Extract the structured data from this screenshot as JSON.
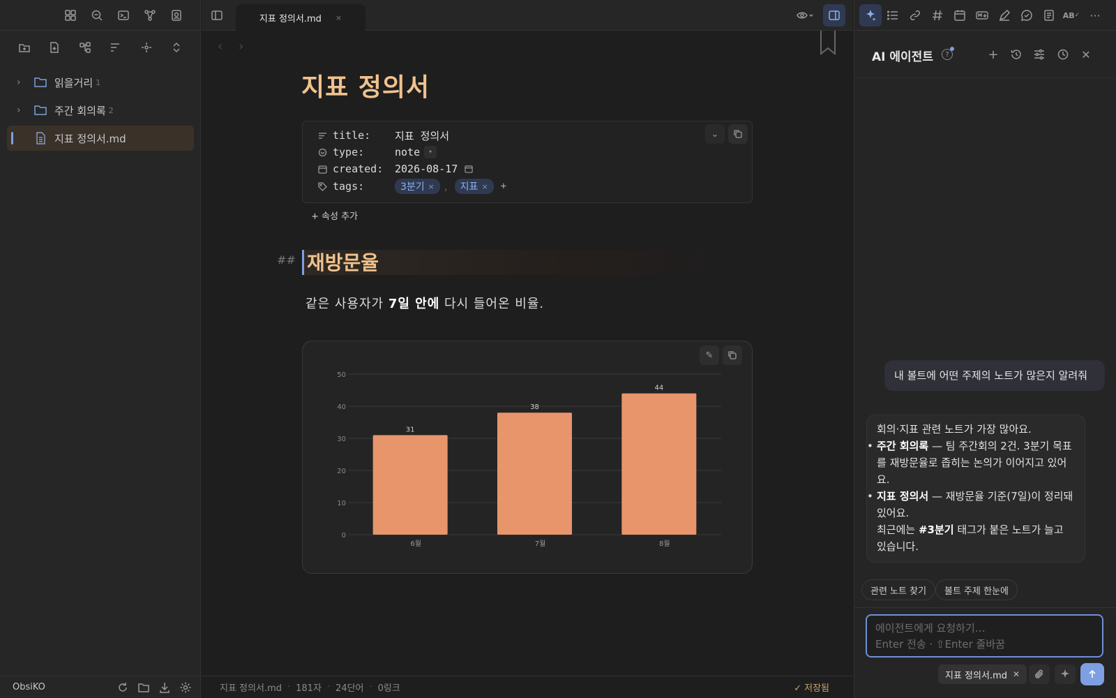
{
  "left_sidebar": {
    "tree": [
      {
        "label": "읽을거리",
        "count": "1"
      },
      {
        "label": "주간 회의록",
        "count": "2"
      },
      {
        "label": "지표 정의서.md",
        "count": ""
      }
    ],
    "footer_label": "ObsiKO"
  },
  "tab": {
    "label": "지표 정의서.md",
    "close": "×"
  },
  "note": {
    "title": "지표 정의서",
    "properties": {
      "title_key": "title:",
      "title_value": "지표 정의서",
      "type_key": "type:",
      "type_value": "note",
      "created_key": "created:",
      "created_value": "2026-08-17",
      "tags_key": "tags:",
      "tags": [
        "3분기",
        "지표"
      ],
      "tag_sep": ",",
      "tag_add": "+"
    },
    "add_property": "+ 속성 추가",
    "heading_marker": "##",
    "heading": "재방문율",
    "body_pre": "같은 사용자가 ",
    "body_bold": "7일 안에",
    "body_post": " 다시 들어온 비율."
  },
  "chart_data": {
    "type": "bar",
    "categories": [
      "6월",
      "7월",
      "8월"
    ],
    "values": [
      31,
      38,
      44
    ],
    "data_labels": [
      "31",
      "38",
      "44"
    ],
    "ylim": [
      0,
      50
    ],
    "yticks": [
      0,
      10,
      20,
      30,
      40,
      50
    ],
    "grid": true,
    "bar_color": "#e8956b"
  },
  "status_bar": {
    "file": "지표 정의서.md",
    "chars": "181자",
    "words": "24단어",
    "links": "0링크",
    "saved": "✓ 저장됨"
  },
  "ai_panel": {
    "title": "AI 에이전트",
    "user_message": "내 볼트에 어떤 주제의 노트가 많은지 알려줘",
    "reply_intro": "회의·지표 관련 노트가 가장 많아요.",
    "reply_items": [
      {
        "bold": "주간 회의록",
        "text": " — 팀 주간회의 2건. 3분기 목표를 재방문율로 좁히는 논의가 이어지고 있어요."
      },
      {
        "bold": "지표 정의서",
        "text": " — 재방문율 기준(7일)이 정리돼 있어요."
      }
    ],
    "reply_outro_pre": "최근에는 ",
    "reply_outro_bold": "#3분기",
    "reply_outro_post": " 태그가 붙은 노트가 늘고 있습니다.",
    "suggestions": [
      "관련 노트 찾기",
      "볼트 주제 한눈에"
    ],
    "input_placeholder": "에이전트에게 요청하기…",
    "input_hint": "Enter 전송 · ⇧Enter 줄바꿈",
    "context_chip": "지표 정의서.md"
  },
  "colors": {
    "accent": "#7f9fe0",
    "heading": "#f0c28d",
    "bar": "#e8956b",
    "background": "#1e1e1e"
  }
}
